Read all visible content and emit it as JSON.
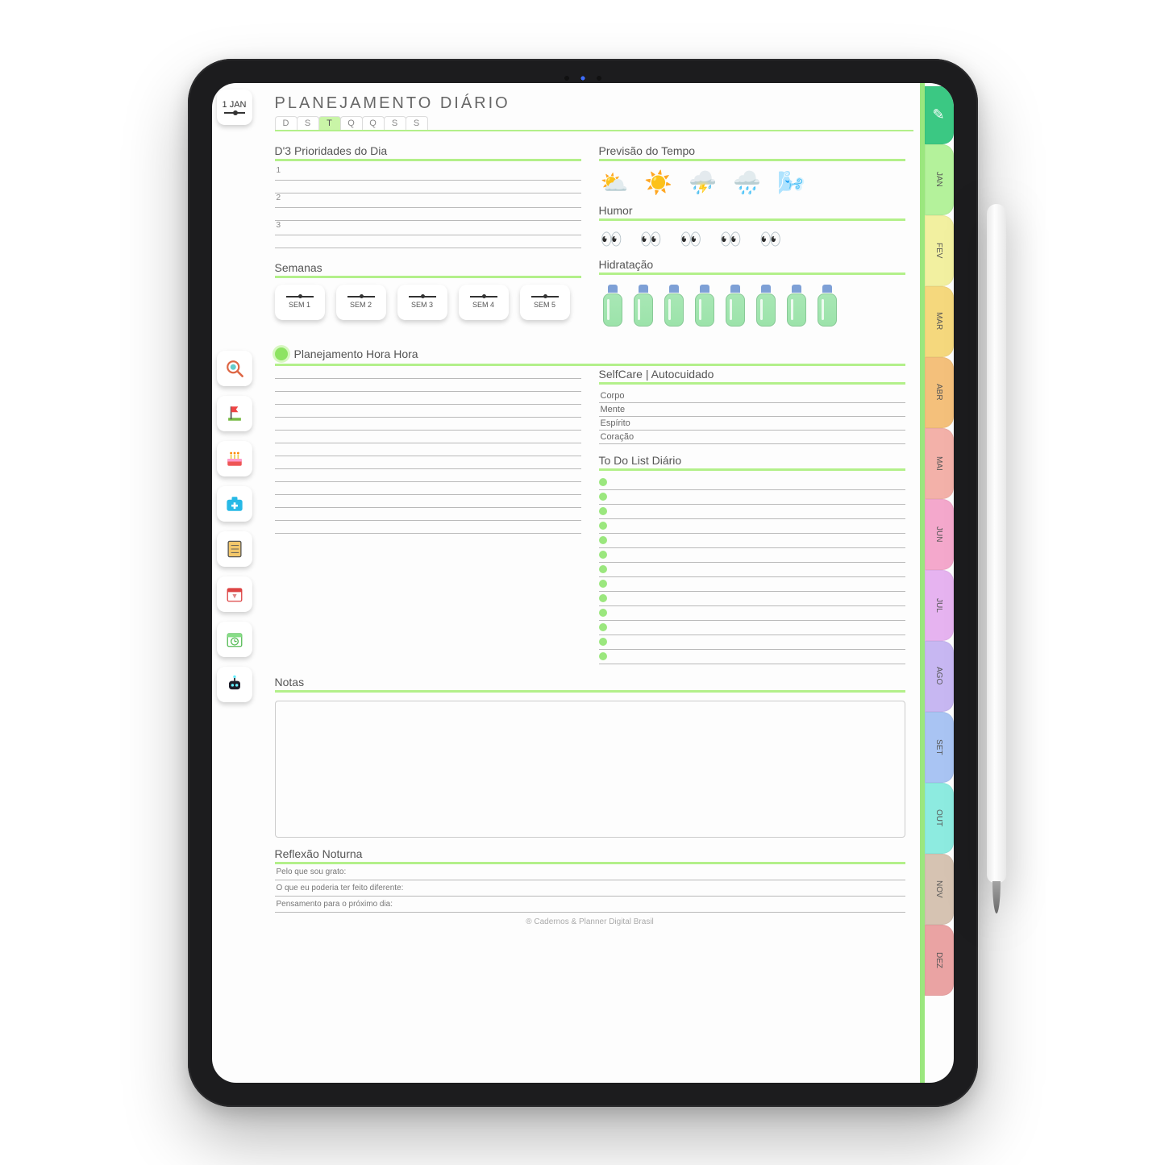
{
  "date_chip": {
    "day": "1",
    "month": "JAN"
  },
  "title": "PLANEJAMENTO DIÁRIO",
  "days": [
    "D",
    "S",
    "T",
    "Q",
    "Q",
    "S",
    "S"
  ],
  "days_active_index": 2,
  "sections": {
    "priorities": "D'3 Prioridades do Dia",
    "weather": "Previsão do Tempo",
    "mood": "Humor",
    "hydration": "Hidratação",
    "weeks": "Semanas",
    "hourly": "Planejamento Hora Hora",
    "selfcare": "SelfCare | Autocuidado",
    "todo": "To Do List Diário",
    "notes": "Notas",
    "reflection": "Reflexão Noturna"
  },
  "priority_nums": [
    "1",
    "2",
    "3"
  ],
  "weeks": [
    "SEM 1",
    "SEM 2",
    "SEM 3",
    "SEM 4",
    "SEM 5"
  ],
  "selfcare": [
    "Corpo",
    "Mente",
    "Espírito",
    "Coração"
  ],
  "reflection": [
    "Pelo que sou grato:",
    "O que eu poderia ter feito diferente:",
    "Pensamento para o próximo dia:"
  ],
  "footer": "® Cadernos & Planner Digital Brasil",
  "month_tabs": [
    {
      "label": "✎",
      "color": "#3bc883",
      "icon": true
    },
    {
      "label": "JAN",
      "color": "#b4f29b"
    },
    {
      "label": "FEV",
      "color": "#f2f0a0"
    },
    {
      "label": "MAR",
      "color": "#f5d87d"
    },
    {
      "label": "ABR",
      "color": "#f4c07b"
    },
    {
      "label": "MAI",
      "color": "#f3b1a9"
    },
    {
      "label": "JUN",
      "color": "#f4a8cc"
    },
    {
      "label": "JUL",
      "color": "#e6b3f0"
    },
    {
      "label": "AGO",
      "color": "#c7b7f2"
    },
    {
      "label": "SET",
      "color": "#a9c4f3"
    },
    {
      "label": "OUT",
      "color": "#8debe0"
    },
    {
      "label": "NOV",
      "color": "#d6c3b2"
    },
    {
      "label": "DEZ",
      "color": "#eaa3a3"
    }
  ],
  "sidebar_icons": [
    {
      "name": "search-food-icon"
    },
    {
      "name": "goal-flag-icon"
    },
    {
      "name": "birthday-cake-icon"
    },
    {
      "name": "medical-kit-icon"
    },
    {
      "name": "checklist-icon"
    },
    {
      "name": "calendar-timer-icon"
    },
    {
      "name": "calendar-clock-icon"
    },
    {
      "name": "robot-icon"
    }
  ],
  "weather_icons": [
    "partly-sunny",
    "sunny",
    "stormy",
    "rainy",
    "windy"
  ],
  "mood_count": 5,
  "bottle_count": 8,
  "todo_count": 13,
  "hour_line_count": 13
}
